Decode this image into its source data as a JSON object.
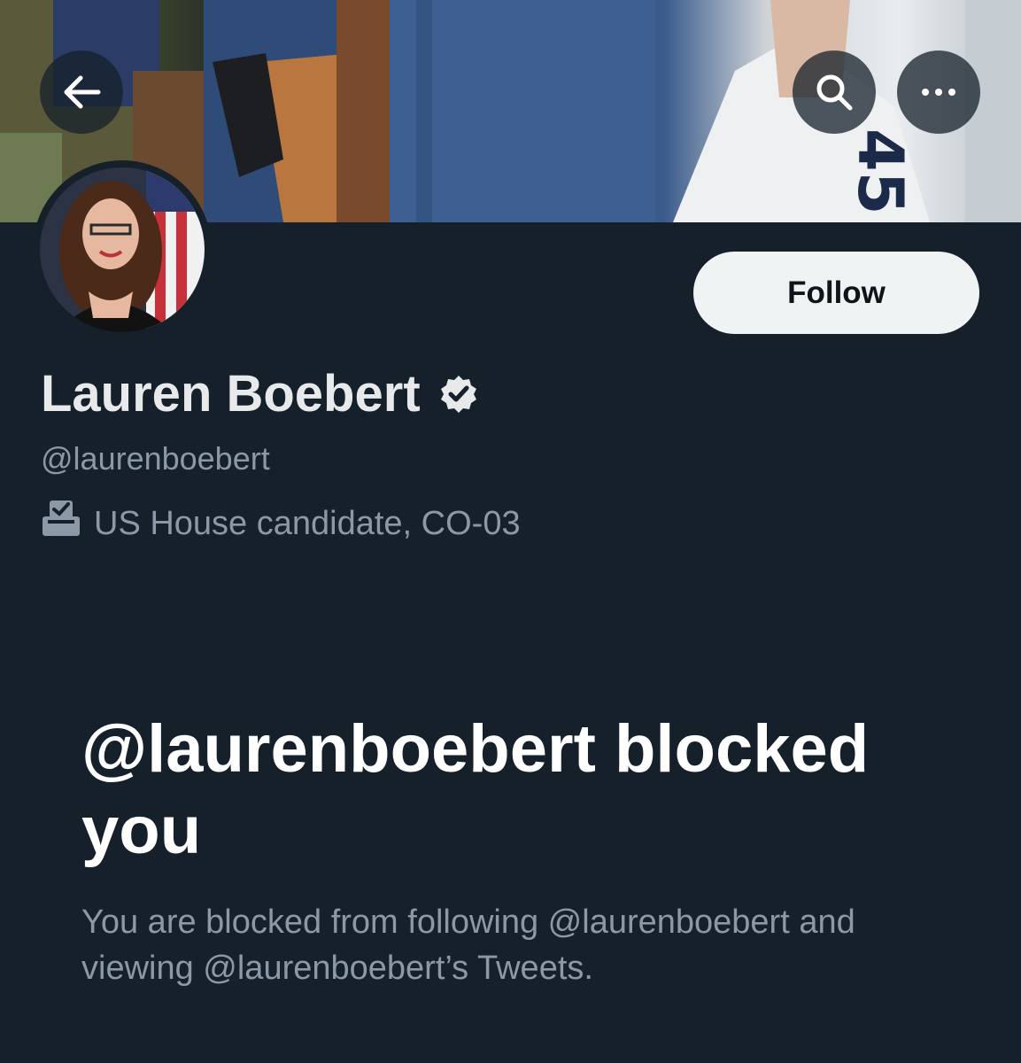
{
  "header": {
    "back_icon": "back-arrow-icon",
    "search_icon": "search-icon",
    "more_icon": "more-dots-icon"
  },
  "profile": {
    "display_name": "Lauren Boebert",
    "verified_icon": "verified-badge-icon",
    "handle": "@laurenboebert",
    "category_icon": "ballot-box-icon",
    "category": "US House candidate, CO-03",
    "follow_label": "Follow"
  },
  "blocked": {
    "title": "@laurenboebert blocked you",
    "description": "You are blocked from following @laurenboebert and viewing @laurenboebert’s Tweets."
  },
  "colors": {
    "background": "#15202b",
    "primary_text": "#e7e9ea",
    "secondary_text": "#8b98a5",
    "follow_button_bg": "#eff3f4"
  }
}
